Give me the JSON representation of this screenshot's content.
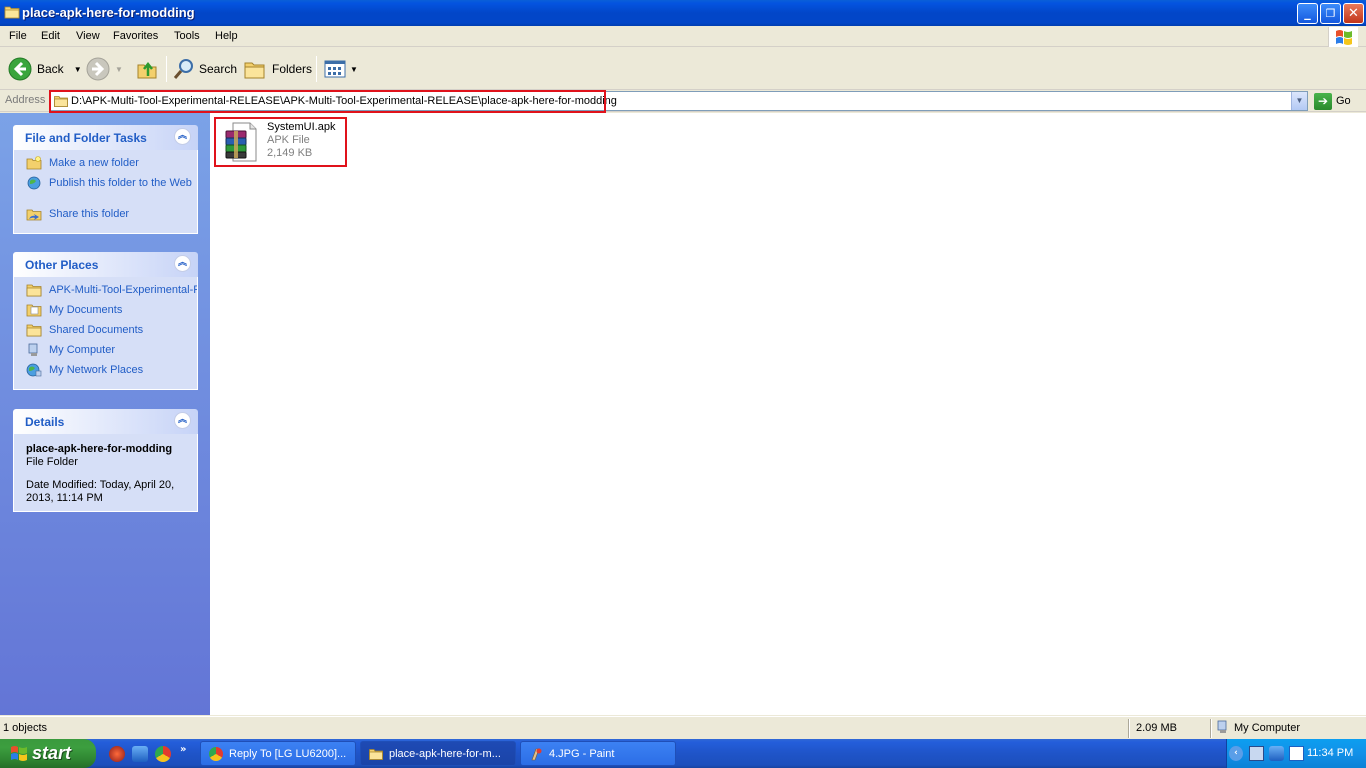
{
  "window": {
    "title": "place-apk-here-for-modding"
  },
  "menu": {
    "items": [
      "File",
      "Edit",
      "View",
      "Favorites",
      "Tools",
      "Help"
    ]
  },
  "toolbar": {
    "back_label": "Back",
    "search_label": "Search",
    "folders_label": "Folders"
  },
  "address": {
    "label": "Address",
    "value": "D:\\APK-Multi-Tool-Experimental-RELEASE\\APK-Multi-Tool-Experimental-RELEASE\\place-apk-here-for-modding",
    "go_label": "Go"
  },
  "tasks_panel": {
    "title": "File and Folder Tasks",
    "links": [
      {
        "label": "Make a new folder",
        "icon": "new-folder-icon"
      },
      {
        "label": "Publish this folder to the Web",
        "icon": "publish-web-icon"
      },
      {
        "label": "Share this folder",
        "icon": "share-folder-icon"
      }
    ]
  },
  "places_panel": {
    "title": "Other Places",
    "links": [
      {
        "label": "APK-Multi-Tool-Experimental-RELEASE",
        "icon": "folder-icon"
      },
      {
        "label": "My Documents",
        "icon": "my-documents-icon"
      },
      {
        "label": "Shared Documents",
        "icon": "shared-documents-icon"
      },
      {
        "label": "My Computer",
        "icon": "my-computer-icon"
      },
      {
        "label": "My Network Places",
        "icon": "network-places-icon"
      }
    ]
  },
  "details_panel": {
    "title": "Details",
    "name": "place-apk-here-for-modding",
    "type": "File Folder",
    "modified": "Date Modified: Today, April 20, 2013, 11:14 PM"
  },
  "files": [
    {
      "name": "SystemUI.apk",
      "type": "APK File",
      "size": "2,149 KB",
      "icon": "winrar-archive-icon"
    }
  ],
  "status": {
    "objects": "1 objects",
    "size": "2.09 MB",
    "location": "My Computer"
  },
  "taskbar": {
    "start_label": "start",
    "tasks": [
      {
        "label": "Reply To [LG LU6200]...",
        "icon": "chrome-icon",
        "active": false
      },
      {
        "label": "place-apk-here-for-m...",
        "icon": "folder-icon",
        "active": true
      },
      {
        "label": "4.JPG - Paint",
        "icon": "paint-icon",
        "active": false
      }
    ],
    "clock": "11:34 PM"
  },
  "colors": {
    "highlight_border": "#e0121b",
    "link": "#215dc6",
    "titlebar": "#0246c8"
  }
}
